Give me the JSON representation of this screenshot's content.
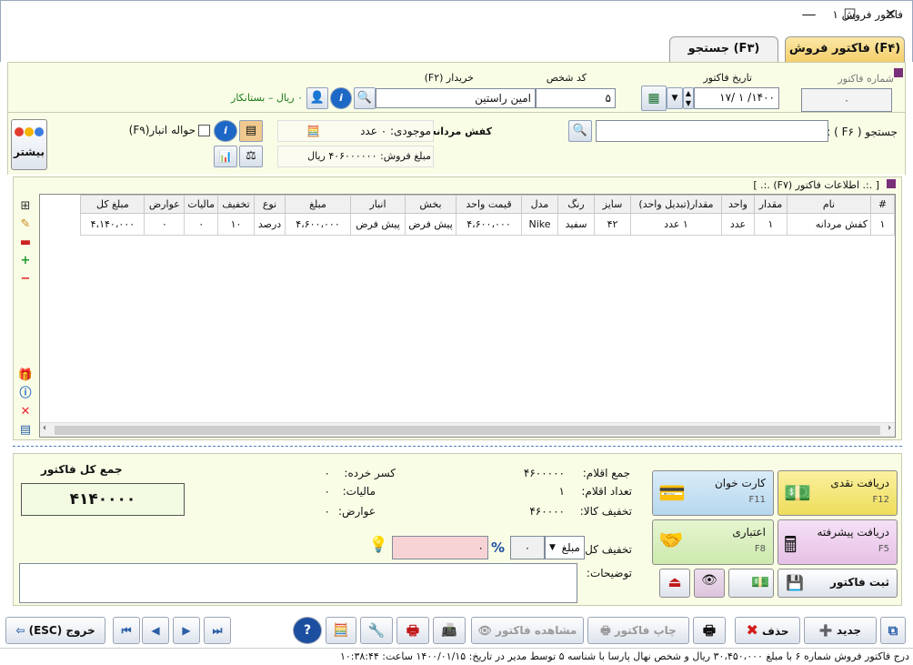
{
  "window": {
    "title": "فاکتور فروش ۱",
    "minimize": "—",
    "maximize": "☐",
    "close": "✕"
  },
  "tabs": [
    {
      "label": "فاکتور فروش (F۴)"
    },
    {
      "label": "جستجو (F۳)"
    }
  ],
  "header": {
    "invoice_number_label": "شماره فاکتور",
    "invoice_number": "۰",
    "invoice_date_label": "تاریخ فاکتور",
    "invoice_date": "۱۴۰۰/ ۱ /۱۷",
    "person_code_label": "کد شخص",
    "person_code": "۵",
    "buyer_label": "خریدار (F۲)",
    "buyer": "امین راستین",
    "balance": "۰ ریال – بستانکار"
  },
  "search": {
    "label": "جستجو ( F۶ ) :",
    "value": ""
  },
  "product": {
    "name": "کفش مردانه :",
    "stock": "موجودی: ۰ عدد",
    "sale_amount": "مبلغ فروش: ۴۰۶۰۰۰۰۰۰ ریال",
    "transfer_label": "حواله انبار(F۹)",
    "more_label": "بیشتر"
  },
  "grid": {
    "section_title": "[ .:. اطلاعات فاکتور (F۷) .:. ]",
    "columns": [
      "#",
      "نام",
      "مقدار",
      "واحد",
      "مقدار(تبدیل واحد)",
      "سایز",
      "رنگ",
      "مدل",
      "قیمت واحد",
      "بخش",
      "انبار",
      "مبلغ",
      "نوع",
      "تخفیف",
      "مالیات",
      "عوارض",
      "مبلغ کل"
    ],
    "rows": [
      [
        "۱",
        "کفش مردانه",
        "۱",
        "عدد",
        "۱ عدد",
        "۴۲",
        "سفید",
        "Nike",
        "۴،۶۰۰،۰۰۰",
        "پیش فرض",
        "پیش فرض",
        "۴،۶۰۰،۰۰۰",
        "درصد",
        "۱۰",
        "۰",
        "۰",
        "۴،۱۴۰،۰۰۰"
      ]
    ]
  },
  "totals": {
    "sum_items_label": "جمع اقلام:",
    "sum_items": "۴۶۰۰۰۰۰",
    "count_items_label": "تعداد اقلام:",
    "count_items": "۱",
    "goods_discount_label": "تخفیف کالا:",
    "goods_discount": "۴۶۰۰۰۰",
    "change_label": "کسر خرده:",
    "change": "۰",
    "tax_label": "مالیات:",
    "tax": "۰",
    "duties_label": "عوارض:",
    "duties": "۰",
    "grand_label": "جمع کل فاکتور",
    "grand": "۴۱۴۰۰۰۰",
    "discount_label": "تخفیف کل:",
    "discount_type": "مبلغ",
    "discount_value": "۰",
    "discount_amount": "۰",
    "notes_label": "توضیحات:",
    "notes": ""
  },
  "payments": {
    "cash": "دریافت نقدی",
    "cash_key": "F12",
    "card": "کارت خوان",
    "card_key": "F11",
    "advanced": "دریافت پیشرفته",
    "advanced_key": "F5",
    "credit": "اعتباری",
    "credit_key": "F8",
    "save": "ثبت فاکتور"
  },
  "toolbar": {
    "new": "جدید",
    "delete": "حذف",
    "print_invoice": "چاپ فاکتور",
    "view_invoice": "مشاهده فاکتور",
    "exit": "خروج (ESC)"
  },
  "status": "درج فاکتور فروش شماره ۶ با مبلغ ۳۰،۴۵۰،۰۰۰ ریال و شخص نهال پارسا با شناسه ۵ توسط مدیر در تاریخ: ۱۴۰۰/۰۱/۱۵ ساعت: ۱۰:۳۸:۴۴",
  "colors": {
    "accent": "#f7d67a",
    "panel": "#fafde6",
    "green": "#1a7a1a"
  }
}
